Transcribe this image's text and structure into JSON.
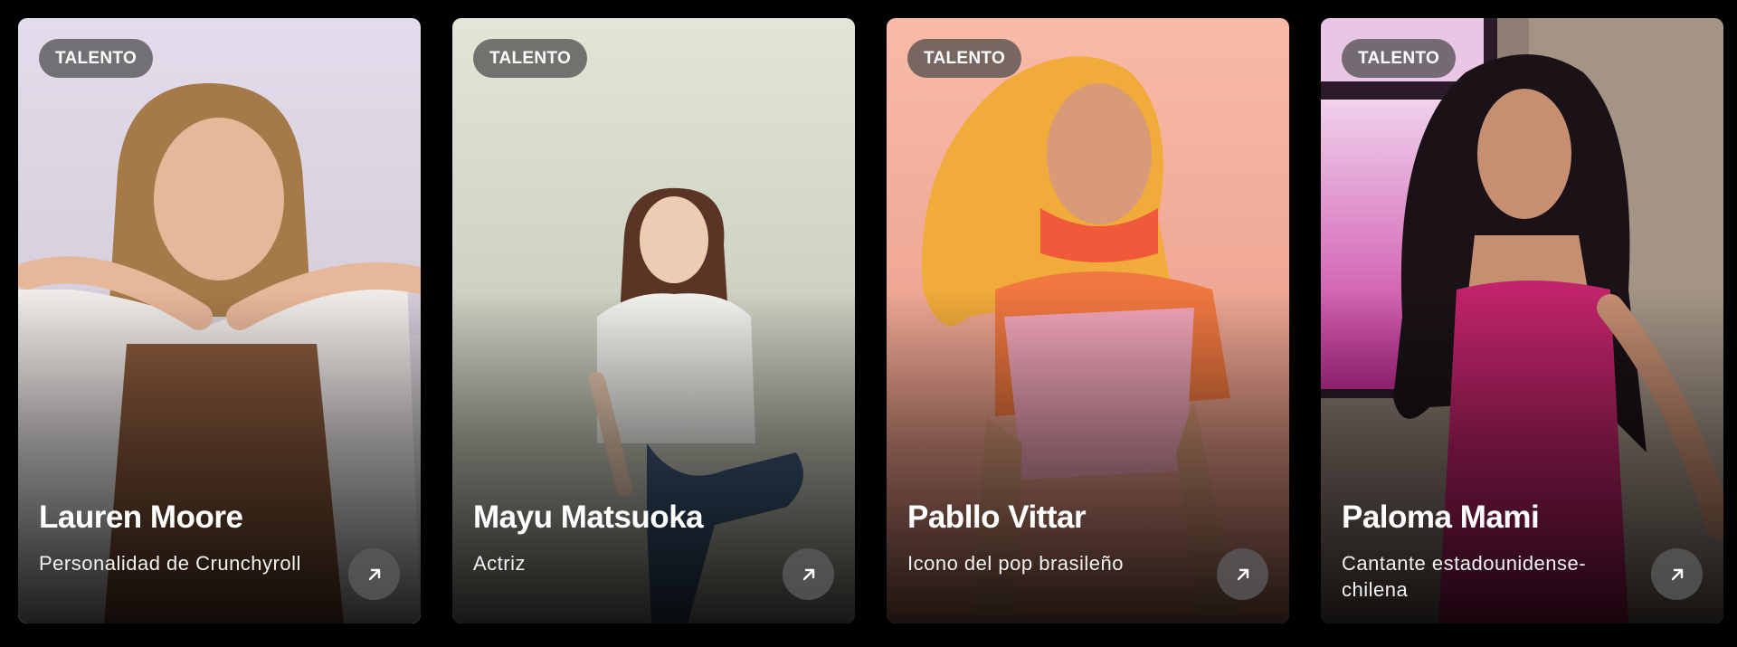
{
  "cards": [
    {
      "badge": "TALENTO",
      "name": "Lauren Moore",
      "description": "Personalidad de Crunchyroll",
      "icon": "arrow-up-right-icon",
      "colors": {
        "bg_top": "#dcd6e6",
        "bg_bottom": "#c9c1cc",
        "hair": "#a67a48",
        "skin": "#e7b79a",
        "cloth": "#8a5a3c"
      }
    },
    {
      "badge": "TALENTO",
      "name": "Mayu Matsuoka",
      "description": "Actriz",
      "icon": "arrow-up-right-icon",
      "colors": {
        "bg_top": "#dfe3d3",
        "bg_bottom": "#b9bdae",
        "hair": "#5a3424",
        "skin": "#eccdb4",
        "cloth": "#f2f2ee"
      }
    },
    {
      "badge": "TALENTO",
      "name": "Pabllo Vittar",
      "description": "Icono del pop brasileño",
      "icon": "arrow-up-right-icon",
      "colors": {
        "bg_top": "#f7b9a6",
        "bg_bottom": "#e99a86",
        "hair": "#f0ab3a",
        "skin": "#d99a78",
        "cloth": "#f2a6b8"
      }
    },
    {
      "badge": "TALENTO",
      "name": "Paloma Mami",
      "description": "Cantante estadounidense-chilena",
      "icon": "arrow-up-right-icon",
      "colors": {
        "bg_top": "#9d8d82",
        "bg_bottom": "#6d5e58",
        "hair": "#1a1216",
        "skin": "#c68f72",
        "cloth": "#c0246a"
      }
    }
  ]
}
